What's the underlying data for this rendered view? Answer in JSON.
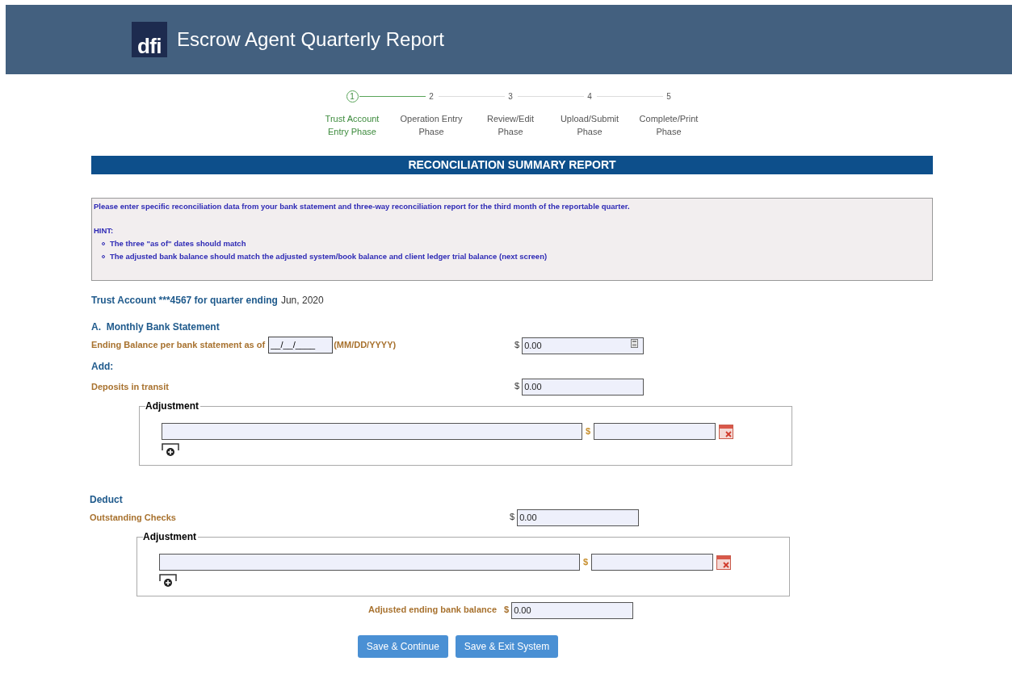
{
  "header": {
    "logo": "dfi",
    "title": "Escrow Agent Quarterly Report"
  },
  "steps": [
    {
      "number": "1",
      "label": "Trust Account Entry Phase",
      "selected": true
    },
    {
      "number": "2",
      "label": "Operation Entry Phase",
      "selected": false
    },
    {
      "number": "3",
      "label": "Review/Edit Phase",
      "selected": false
    },
    {
      "number": "4",
      "label": "Upload/Submit Phase",
      "selected": false
    },
    {
      "number": "5",
      "label": "Complete/Print Phase",
      "selected": false
    }
  ],
  "report_title": "RECONCILIATION SUMMARY REPORT",
  "instructions": {
    "text": "Please enter specific reconciliation data from your bank statement and three-way reconciliation report for the third month of the reportable quarter.",
    "hint_label": "HINT:",
    "hints": [
      "The three \"as of\" dates should match",
      "The adjusted bank balance should match the adjusted system/book balance and client ledger trial balance (next screen)"
    ]
  },
  "account": {
    "label": "Trust Account ***4567 for quarter ending",
    "period": "Jun, 2020"
  },
  "section_a": {
    "heading": "A.  Monthly Bank Statement",
    "ending_balance": {
      "label": "Ending Balance per bank statement as of",
      "date_value": "__/__/____",
      "date_format": "(MM/DD/YYYY)",
      "currency": "$",
      "value": "0.00"
    }
  },
  "add": {
    "heading": "Add:",
    "label": "Deposits in transit",
    "currency": "$",
    "value": "0.00",
    "adjustment": {
      "legend": "Adjustment",
      "currency": "$"
    }
  },
  "deduct": {
    "heading": "Deduct",
    "label": "Outstanding Checks",
    "currency": "$",
    "value": "0.00",
    "adjustment": {
      "legend": "Adjustment",
      "currency": "$"
    }
  },
  "adjusted": {
    "label": "Adjusted ending bank balance",
    "currency": "$",
    "value": "0.00"
  },
  "buttons": [
    "Save & Continue",
    "Save & Exit System"
  ]
}
